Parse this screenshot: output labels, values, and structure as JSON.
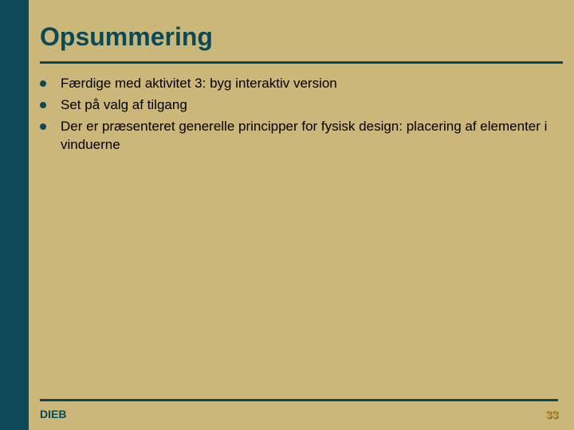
{
  "title": "Opsummering",
  "bullets": [
    "Færdige med aktivitet 3: byg interaktiv version",
    "Set på valg af tilgang",
    "Der er præsenteret generelle principper for fysisk design: placering af elementer i vinduerne"
  ],
  "footer": {
    "left": "DIEB",
    "right": "33"
  }
}
